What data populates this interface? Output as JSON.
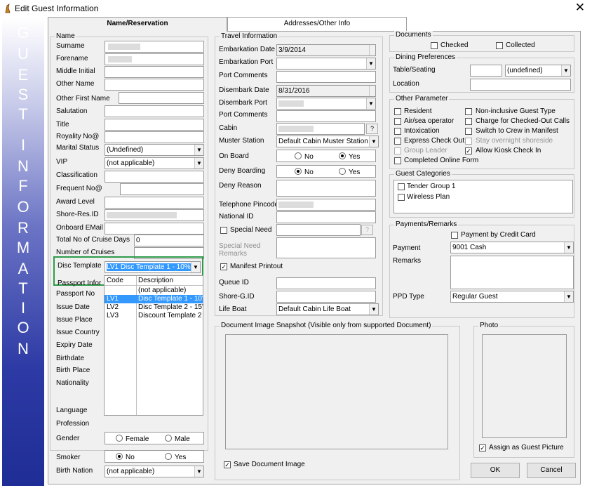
{
  "window": {
    "title": "Edit Guest Information",
    "close": "✕"
  },
  "banner": [
    "G",
    "U",
    "E",
    "S",
    "T",
    "I",
    "N",
    "F",
    "O",
    "R",
    "M",
    "A",
    "T",
    "I",
    "O",
    "N"
  ],
  "tabs": {
    "name": "Name/Reservation",
    "address": "Addresses/Other Info"
  },
  "name_group": {
    "title": "Name",
    "surname": "Surname",
    "forename": "Forename",
    "middle_initial": "Middle Initial",
    "other_name": "Other Name",
    "other_first_name": "Other First Name",
    "salutation": "Salutation",
    "title_lbl": "Title",
    "royality": "Royality No@",
    "marital": "Marital Status",
    "marital_value": "(Undefined)",
    "vip": "VIP",
    "vip_value": "(not applicable)",
    "classification": "Classification",
    "frequent": "Frequent No@",
    "award": "Award Level",
    "shore_res": "Shore-Res.ID",
    "onboard_email": "Onboard EMail",
    "total_days": "Total No of Cruise Days",
    "total_days_value": "0",
    "num_cruises": "Number of Cruises",
    "disc_template": "Disc Template",
    "disc_value": "LV1 Disc Template 1 - 10%"
  },
  "passport": {
    "title": "Passport Infor",
    "passport_no": "Passport No",
    "issue_date": "Issue Date",
    "issue_place": "Issue Place",
    "issue_country": "Issue Country",
    "expiry": "Expiry Date",
    "birthdate": "Birthdate",
    "birth_place": "Birth Place",
    "nationality": "Nationality",
    "language": "Language",
    "profession": "Profession",
    "gender": "Gender",
    "female": "Female",
    "male": "Male",
    "smoker": "Smoker",
    "no": "No",
    "yes": "Yes",
    "birth_nation": "Birth Nation",
    "birth_nation_value": "(not applicable)"
  },
  "disc_list": {
    "col_code": "Code",
    "col_desc": "Description",
    "rows": [
      {
        "code": "",
        "desc": "(not applicable)"
      },
      {
        "code": "LV1",
        "desc": "Disc Template 1 - 10'"
      },
      {
        "code": "LV2",
        "desc": "Disc Template 2 - 15'"
      },
      {
        "code": "LV3",
        "desc": "Discount Template 2"
      }
    ]
  },
  "travel": {
    "title": "Travel Information",
    "embark_date": "Embarkation Date",
    "embark_date_value": "3/9/2014",
    "embark_port": "Embarkation Port",
    "port_comments": "Port Comments",
    "disembark_date": "Disembark Date",
    "disembark_date_value": "8/31/2016",
    "disembark_port": "Disembark Port",
    "port_comments2": "Port Comments",
    "cabin": "Cabin",
    "cabin_btn": "?",
    "muster": "Muster Station",
    "muster_value": "Default Cabin Muster Station",
    "onboard": "On Board",
    "no": "No",
    "yes": "Yes",
    "deny_boarding": "Deny Boarding",
    "deny_reason": "Deny Reason",
    "tel_pin": "Telephone Pincode",
    "national_id": "National ID",
    "special_need": "Special Need",
    "special_btn": "?",
    "special_remarks": "Special Need Remarks",
    "manifest": "Manifest Printout",
    "queue_id": "Queue ID",
    "shore_gid": "Shore-G.ID",
    "life_boat": "Life Boat",
    "life_boat_value": "Default Cabin Life Boat"
  },
  "documents": {
    "title": "Documents",
    "checked": "Checked",
    "collected": "Collected"
  },
  "dining": {
    "title": "Dining Preferences",
    "table": "Table/Seating",
    "table_value": "(undefined)",
    "location": "Location"
  },
  "other": {
    "title": "Other Parameter",
    "resident": "Resident",
    "air_sea": "Air/sea operator",
    "intox": "Intoxication",
    "express": "Express Check Out",
    "group_leader": "Group Leader",
    "online": "Completed Online Form",
    "non_incl": "Non-inclusive Guest Type",
    "charge": "Charge for Checked-Out Calls",
    "switch": "Switch to Crew in Manifest",
    "stay": "Stay overnight shoreside",
    "kiosk": "Allow Kiosk Check In"
  },
  "categories": {
    "title": "Guest Categories",
    "items": [
      "Tender Group 1",
      "Wireless Plan"
    ]
  },
  "payments": {
    "title": "Payments/Remarks",
    "by_cc": "Payment by Credit Card",
    "payment": "Payment",
    "payment_value": "9001  Cash",
    "remarks": "Remarks",
    "ppd": "PPD Type",
    "ppd_value": "Regular Guest"
  },
  "doc_image": {
    "title": "Document Image Snapshot (Visible only from supported Document)",
    "save": "Save Document Image"
  },
  "photo": {
    "title": "Photo",
    "assign": "Assign as Guest Picture"
  },
  "buttons": {
    "ok": "OK",
    "cancel": "Cancel"
  },
  "symbols": {
    "dropdown": "▼",
    "check": "✓"
  }
}
